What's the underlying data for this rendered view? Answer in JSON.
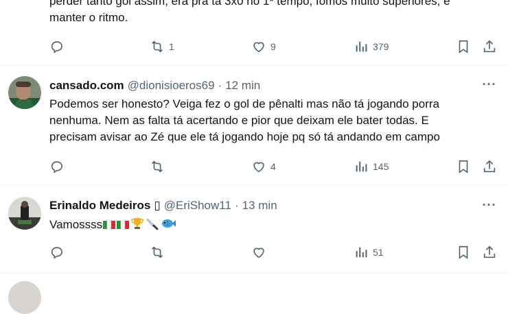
{
  "tweets": [
    {
      "text_lines": [
        "perder tanto gol assim, era pra tá 3x0 no 1º tempo, fomos muito superiores, e",
        "manter o ritmo."
      ],
      "retweets": "1",
      "likes": "9",
      "views": "379"
    },
    {
      "name": "cansado.com",
      "handle": "@dionisioeros69",
      "dot": "·",
      "time": "12 min",
      "text_lines": [
        "Podemos ser honesto? Veiga fez o gol de pênalti mas não tá jogando porra",
        "nenhuma. Nem as falta tá acertando e pior que deixam ele bater todas. E",
        "precisam avisar ao Zé que ele tá jogando hoje pq só tá andando em campo"
      ],
      "retweets": "",
      "likes": "4",
      "views": "145"
    },
    {
      "name": "Erinaldo Medeiros",
      "name_badge": "▯",
      "handle": "@EriShow11",
      "dot": "·",
      "time": "13 min",
      "text": "Vamossss",
      "emojis": [
        "flag-italy-icon",
        "flag-italy-icon",
        "trophy-icon",
        "knife-icon",
        "fish-icon"
      ],
      "retweets": "",
      "likes": "",
      "views": "51"
    }
  ],
  "more_label": "···",
  "colors": {
    "text": "#0f1419",
    "secondary": "#536471",
    "divider": "#eff3f4"
  }
}
